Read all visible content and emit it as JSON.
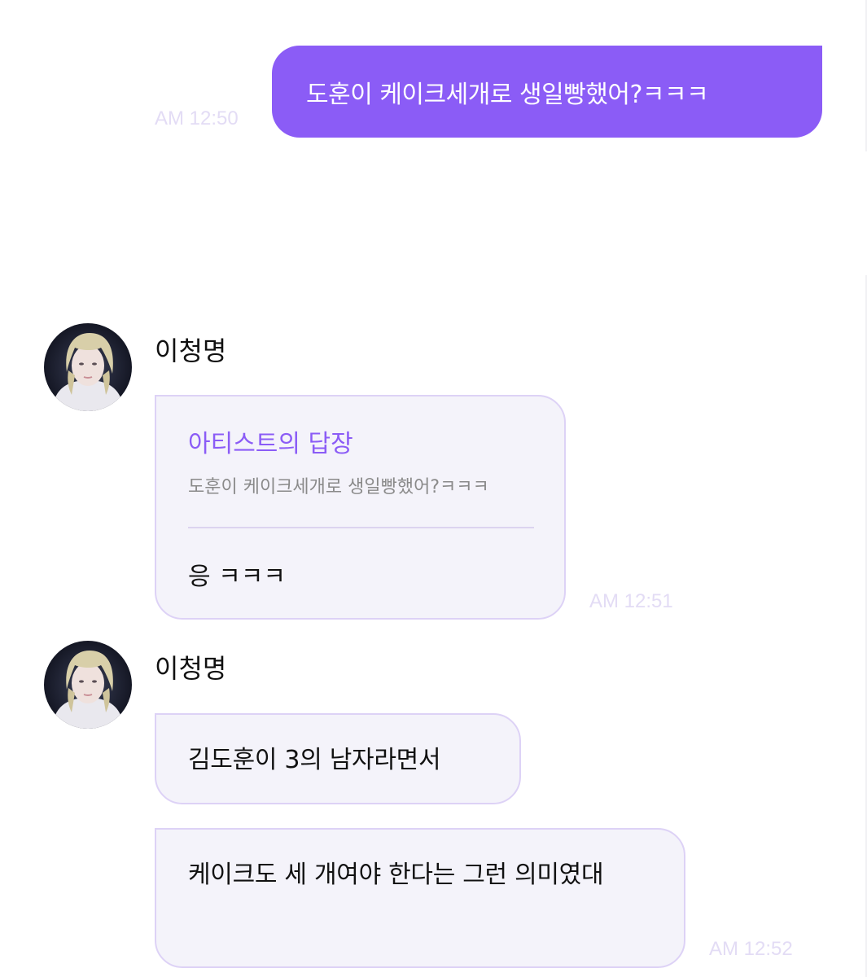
{
  "colors": {
    "accent": "#8b5cf6",
    "bubble_bg": "#f4f3fa",
    "bubble_border": "#ddd2f6",
    "timestamp": "#e3dcf5"
  },
  "sent_message": {
    "text": "도훈이 케이크세개로 생일빵했어?ㅋㅋㅋ",
    "time": "AM 12:50"
  },
  "reply_group": {
    "sender": "이청명",
    "avatar_icon": "artist-avatar",
    "reply_label": "아티스트의 답장",
    "quoted_text": "도훈이 케이크세개로 생일빵했어?ㅋㅋㅋ",
    "reply_text": "응 ㅋㅋㅋ",
    "time": "AM 12:51"
  },
  "message_group": {
    "sender": "이청명",
    "avatar_icon": "artist-avatar",
    "messages": [
      {
        "text": "김도훈이 3의 남자라면서"
      },
      {
        "text": "케이크도 세 개여야 한다는 그런 의미였대"
      }
    ],
    "time": "AM 12:52"
  }
}
